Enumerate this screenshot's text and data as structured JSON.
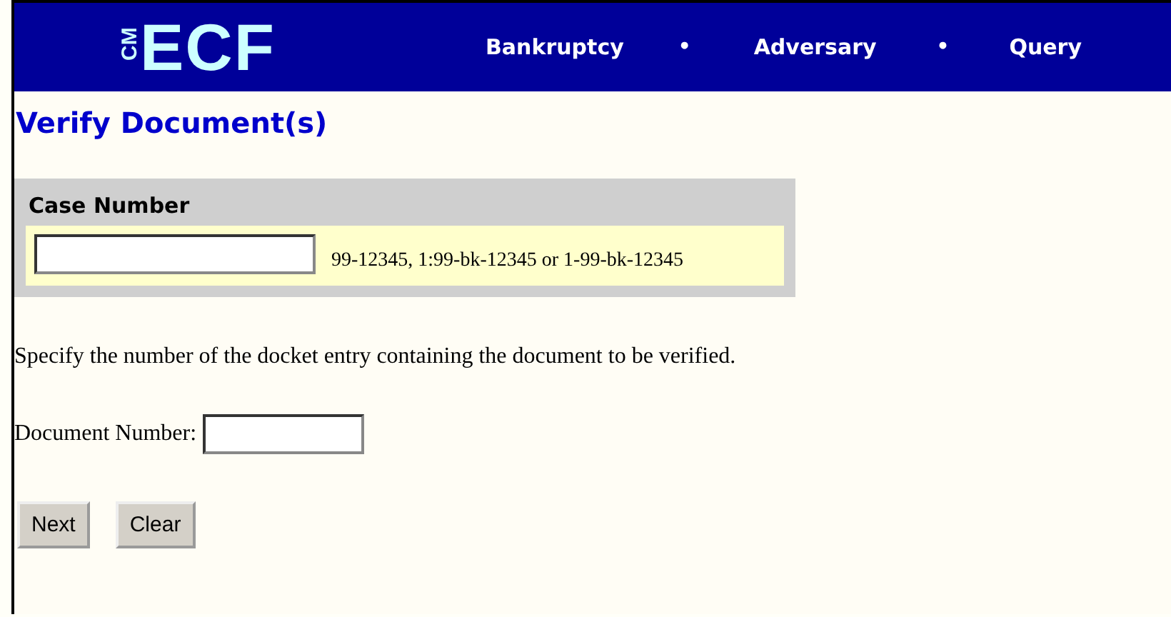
{
  "header": {
    "logo": {
      "prefix": "CM",
      "name": "ECF"
    },
    "nav": [
      {
        "kind": "link",
        "label": "Bankruptcy"
      },
      {
        "kind": "separator",
        "label": "•"
      },
      {
        "kind": "link",
        "label": "Adversary"
      },
      {
        "kind": "separator",
        "label": "•"
      },
      {
        "kind": "link",
        "label": "Query"
      }
    ]
  },
  "title": "Verify Document(s)",
  "case_number": {
    "label": "Case Number",
    "hint": "99-12345, 1:99-bk-12345 or 1-99-bk-12345"
  },
  "instruction": "Specify the number of the docket entry containing the document to be verified.",
  "document_number": {
    "label": "Document Number:"
  },
  "buttons": [
    "Next",
    "Clear"
  ]
}
